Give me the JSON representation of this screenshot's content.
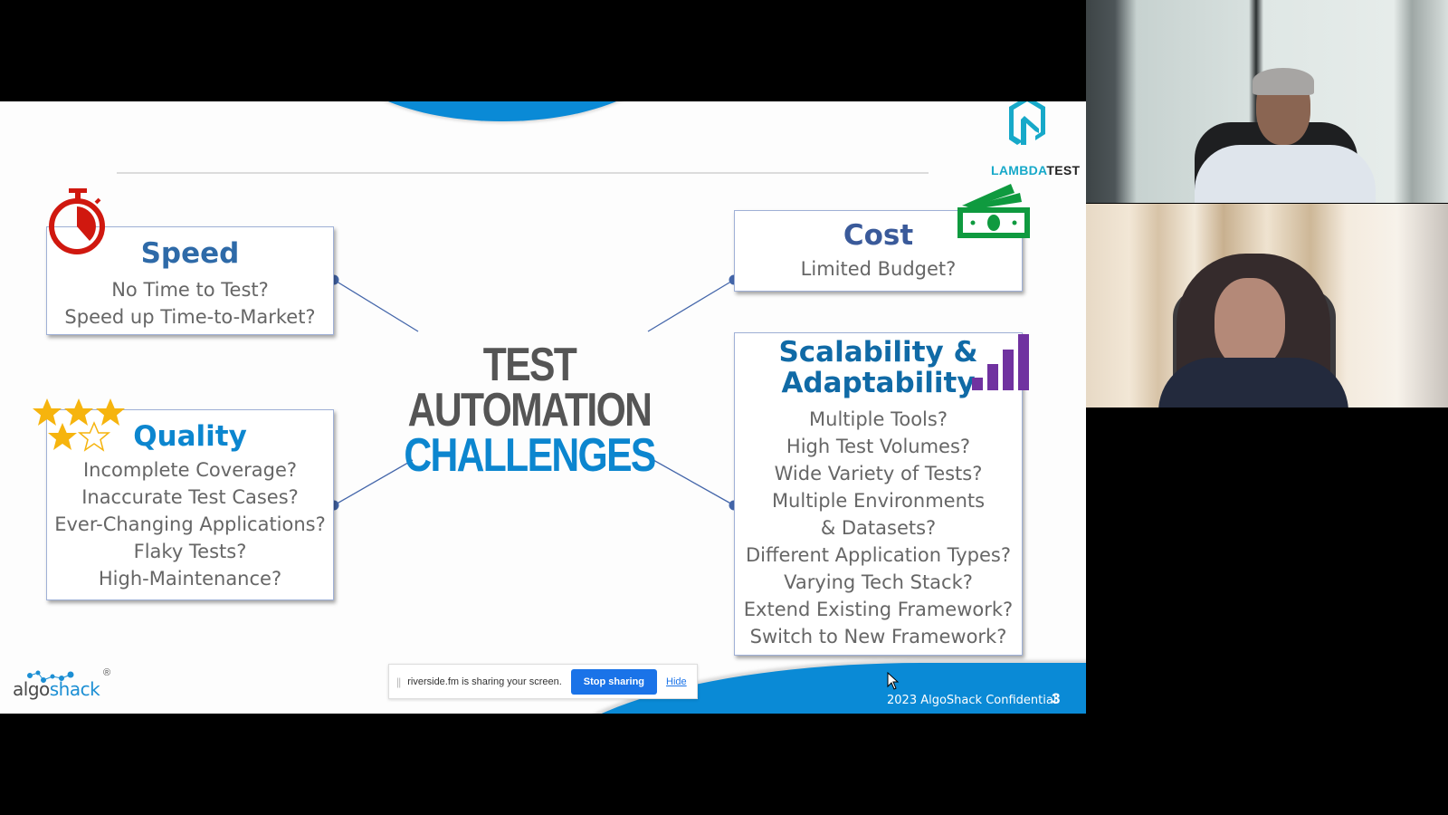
{
  "slide": {
    "center_title": {
      "line1": "TEST AUTOMATION",
      "line2": "CHALLENGES"
    },
    "cards": {
      "speed": {
        "title": "Speed",
        "icon": "stopwatch-icon",
        "lines": [
          "No Time to Test?",
          "Speed up Time-to-Market?"
        ]
      },
      "cost": {
        "title": "Cost",
        "icon": "money-icon",
        "lines": [
          "Limited Budget?"
        ]
      },
      "quality": {
        "title": "Quality",
        "icon": "stars-icon",
        "rating": "3.5 of 5",
        "lines": [
          "Incomplete Coverage?",
          "Inaccurate Test Cases?",
          "Ever-Changing Applications?",
          "Flaky Tests?",
          "High-Maintenance?"
        ]
      },
      "scalability": {
        "title_line1": "Scalability &",
        "title_line2": "Adaptability",
        "icon": "bar-chart-icon",
        "lines": [
          "Multiple Tools?",
          "High Test Volumes?",
          "Wide Variety of Tests?",
          "Multiple Environments",
          "& Datasets?",
          "Different Application Types?",
          "Varying Tech Stack?",
          "Extend Existing Framework?",
          "Switch to New Framework?"
        ]
      }
    },
    "logos": {
      "lambdatest": {
        "part1": "LAMBDA",
        "part2": "TEST"
      },
      "algoshack": {
        "part1": "algo",
        "part2": "shack",
        "registered": "®"
      }
    },
    "footer": {
      "text": "2023 AlgoShack Confidential",
      "page": "3"
    },
    "colors": {
      "accent_blue": "#0a8ad6",
      "title_blue": "#2e6aa8",
      "stopwatch_red": "#d0180f",
      "money_green": "#0f9a3f",
      "bars_purple": "#7032a0",
      "stars_gold": "#f6b40e"
    }
  },
  "share_bar": {
    "message": "riverside.fm is sharing your screen.",
    "stop_label": "Stop sharing",
    "hide_label": "Hide"
  },
  "video_tiles": [
    {
      "participant": "speaker-1"
    },
    {
      "participant": "speaker-2"
    }
  ]
}
